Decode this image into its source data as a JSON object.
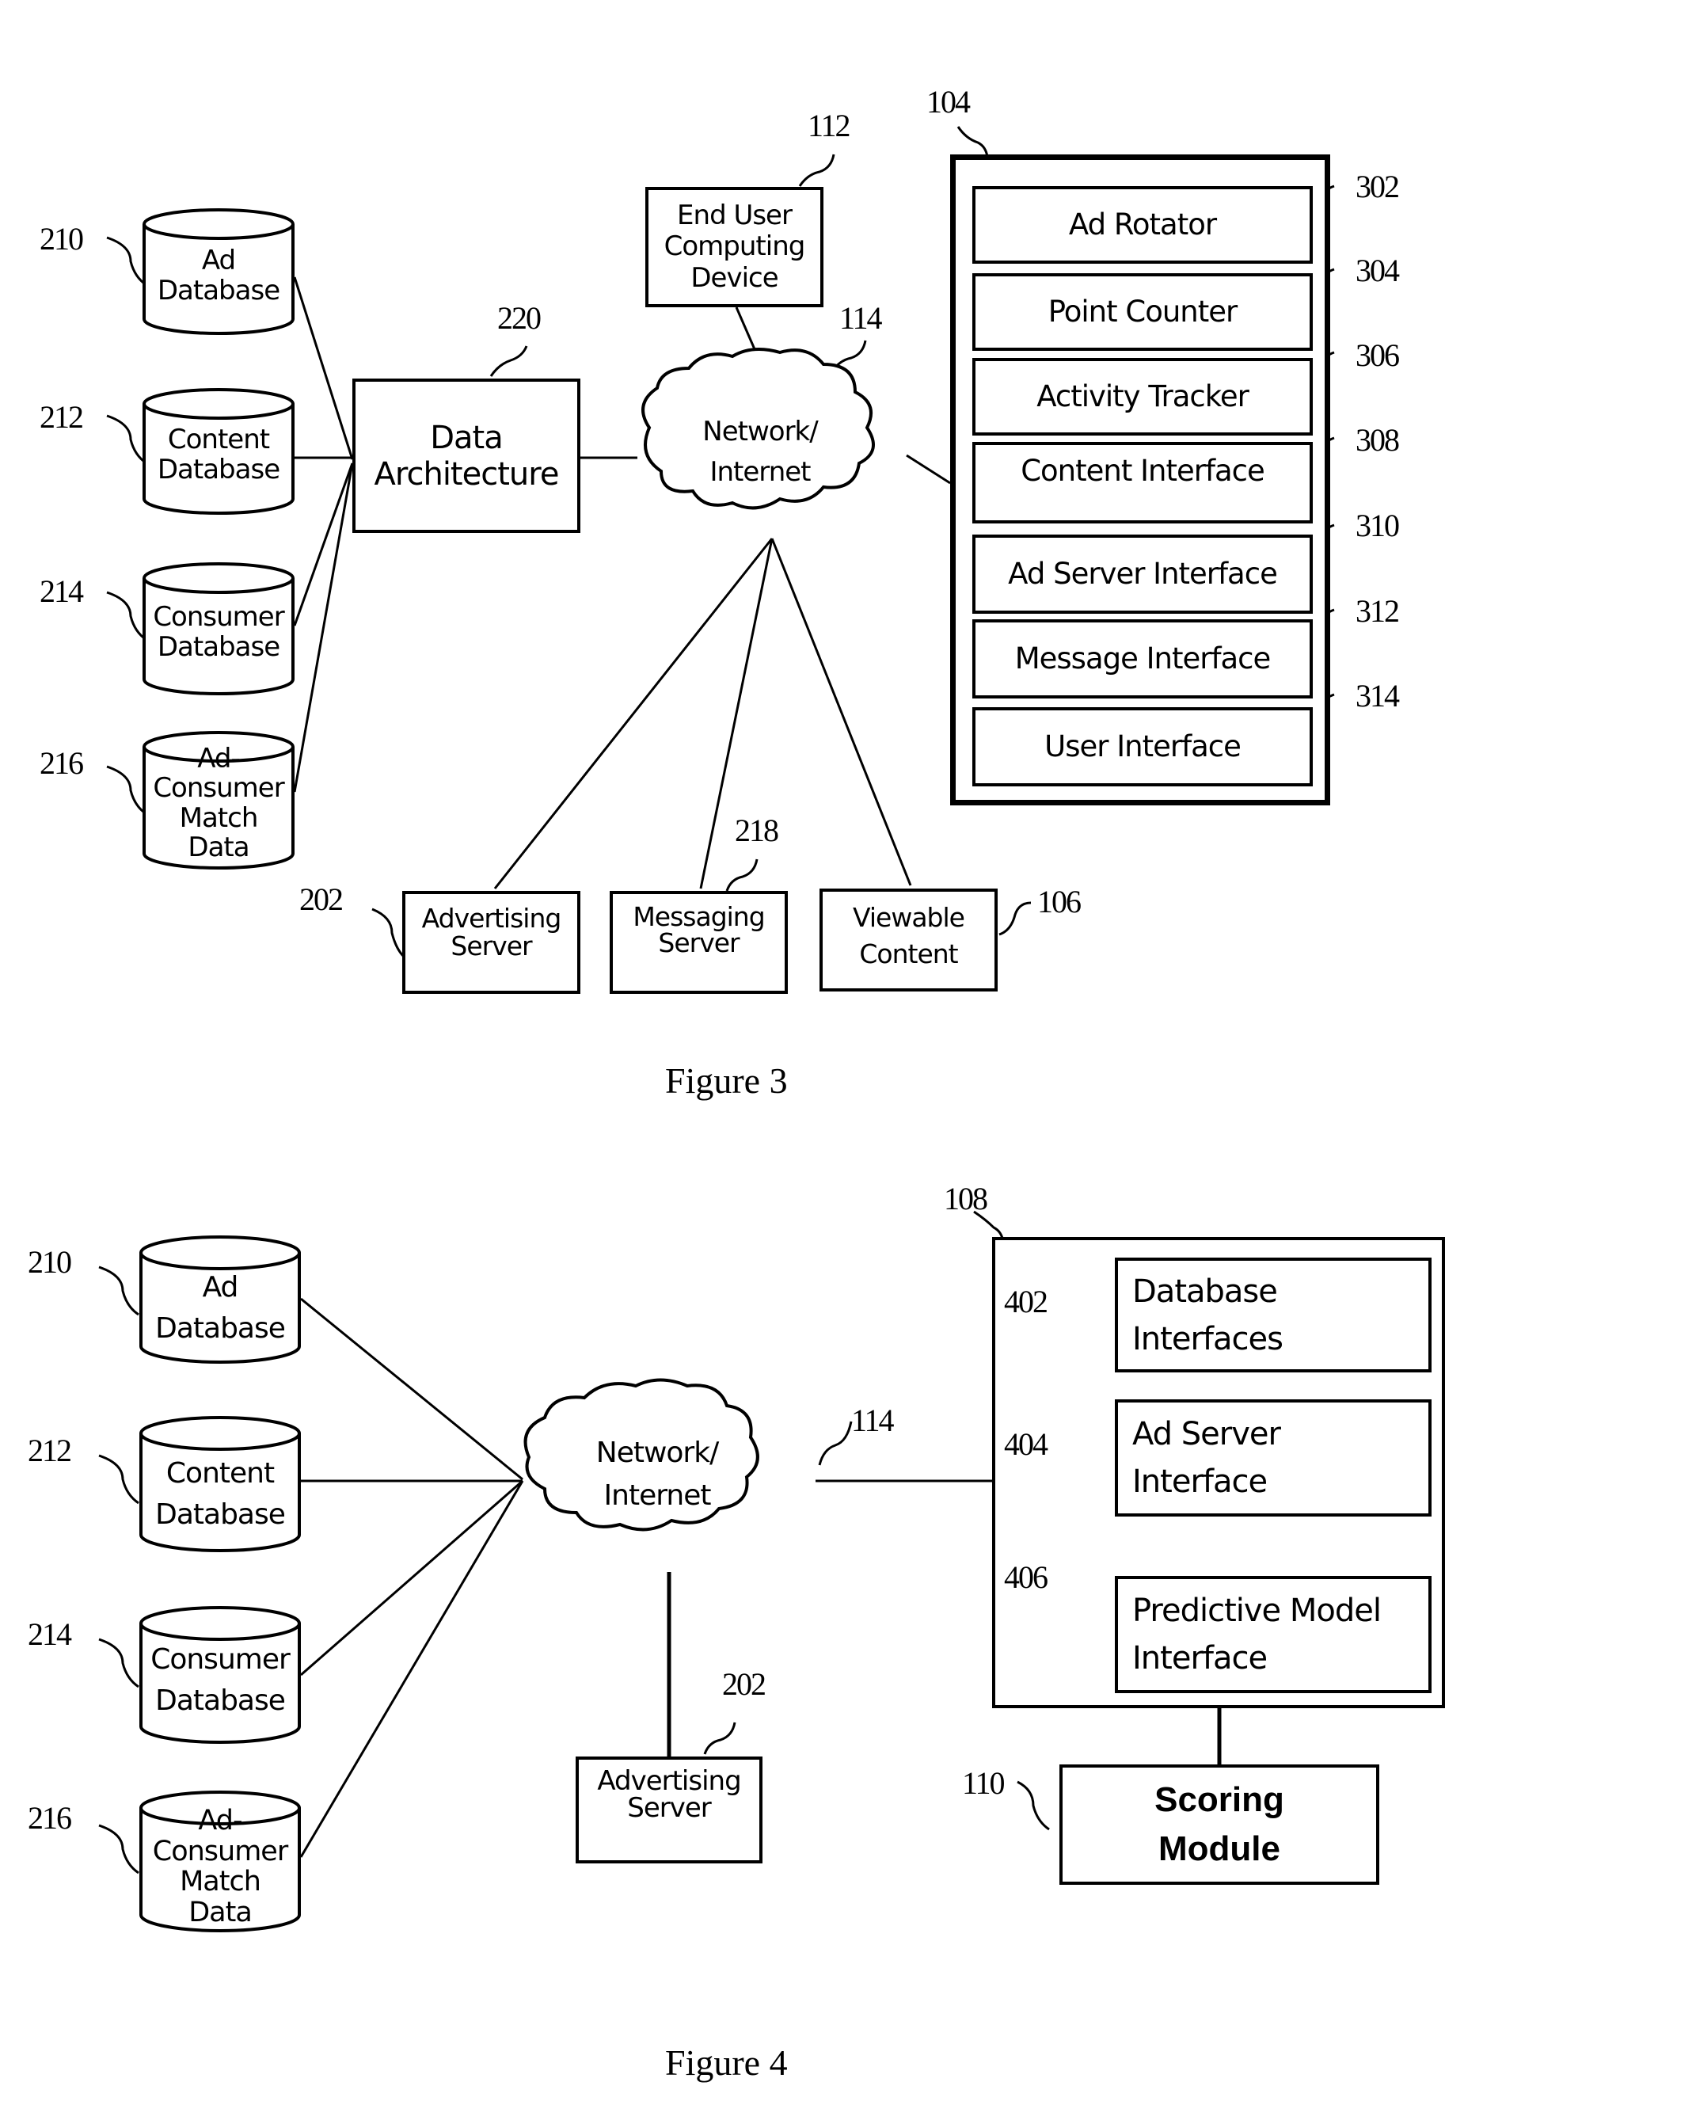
{
  "figure3": {
    "caption": "Figure 3",
    "databases": [
      {
        "ref": "210",
        "label": "Ad\nDatabase"
      },
      {
        "ref": "212",
        "label": "Content\nDatabase"
      },
      {
        "ref": "214",
        "label": "Consumer\nDatabase"
      },
      {
        "ref": "216",
        "label": "Ad-\nConsumer\nMatch\nData"
      }
    ],
    "data_architecture": {
      "ref": "220",
      "label": "Data\nArchitecture"
    },
    "end_user_device": {
      "ref": "112",
      "label": "End User\nComputing\nDevice"
    },
    "network": {
      "ref": "114",
      "label": "Network/\nInternet"
    },
    "device_104": {
      "ref": "104",
      "modules": [
        {
          "ref": "302",
          "label": "Ad Rotator"
        },
        {
          "ref": "304",
          "label": "Point Counter"
        },
        {
          "ref": "306",
          "label": "Activity Tracker"
        },
        {
          "ref": "308",
          "label": "Content Interface"
        },
        {
          "ref": "310",
          "label": "Ad Server Interface"
        },
        {
          "ref": "312",
          "label": "Message Interface"
        },
        {
          "ref": "314",
          "label": "User Interface"
        }
      ]
    },
    "advertising_server": {
      "ref": "202",
      "label": "Advertising\nServer"
    },
    "messaging_server": {
      "ref": "218",
      "label": "Messaging\nServer"
    },
    "viewable_content": {
      "ref": "106",
      "label": "Viewable\nContent"
    }
  },
  "figure4": {
    "caption": "Figure 4",
    "databases": [
      {
        "ref": "210",
        "label": "Ad\nDatabase"
      },
      {
        "ref": "212",
        "label": "Content\nDatabase"
      },
      {
        "ref": "214",
        "label": "Consumer\nDatabase"
      },
      {
        "ref": "216",
        "label": "Ad-\nConsumer\nMatch\nData"
      }
    ],
    "network": {
      "ref": "114",
      "label": "Network/\nInternet"
    },
    "advertising_server": {
      "ref": "202",
      "label": "Advertising\nServer"
    },
    "system_108": {
      "ref": "108",
      "modules": [
        {
          "ref": "402",
          "label": "Database\nInterfaces"
        },
        {
          "ref": "404",
          "label": "Ad Server\nInterface"
        },
        {
          "ref": "406",
          "label": "Predictive Model\nInterface"
        }
      ]
    },
    "scoring_module": {
      "ref": "110",
      "label": "Scoring\nModule"
    }
  }
}
